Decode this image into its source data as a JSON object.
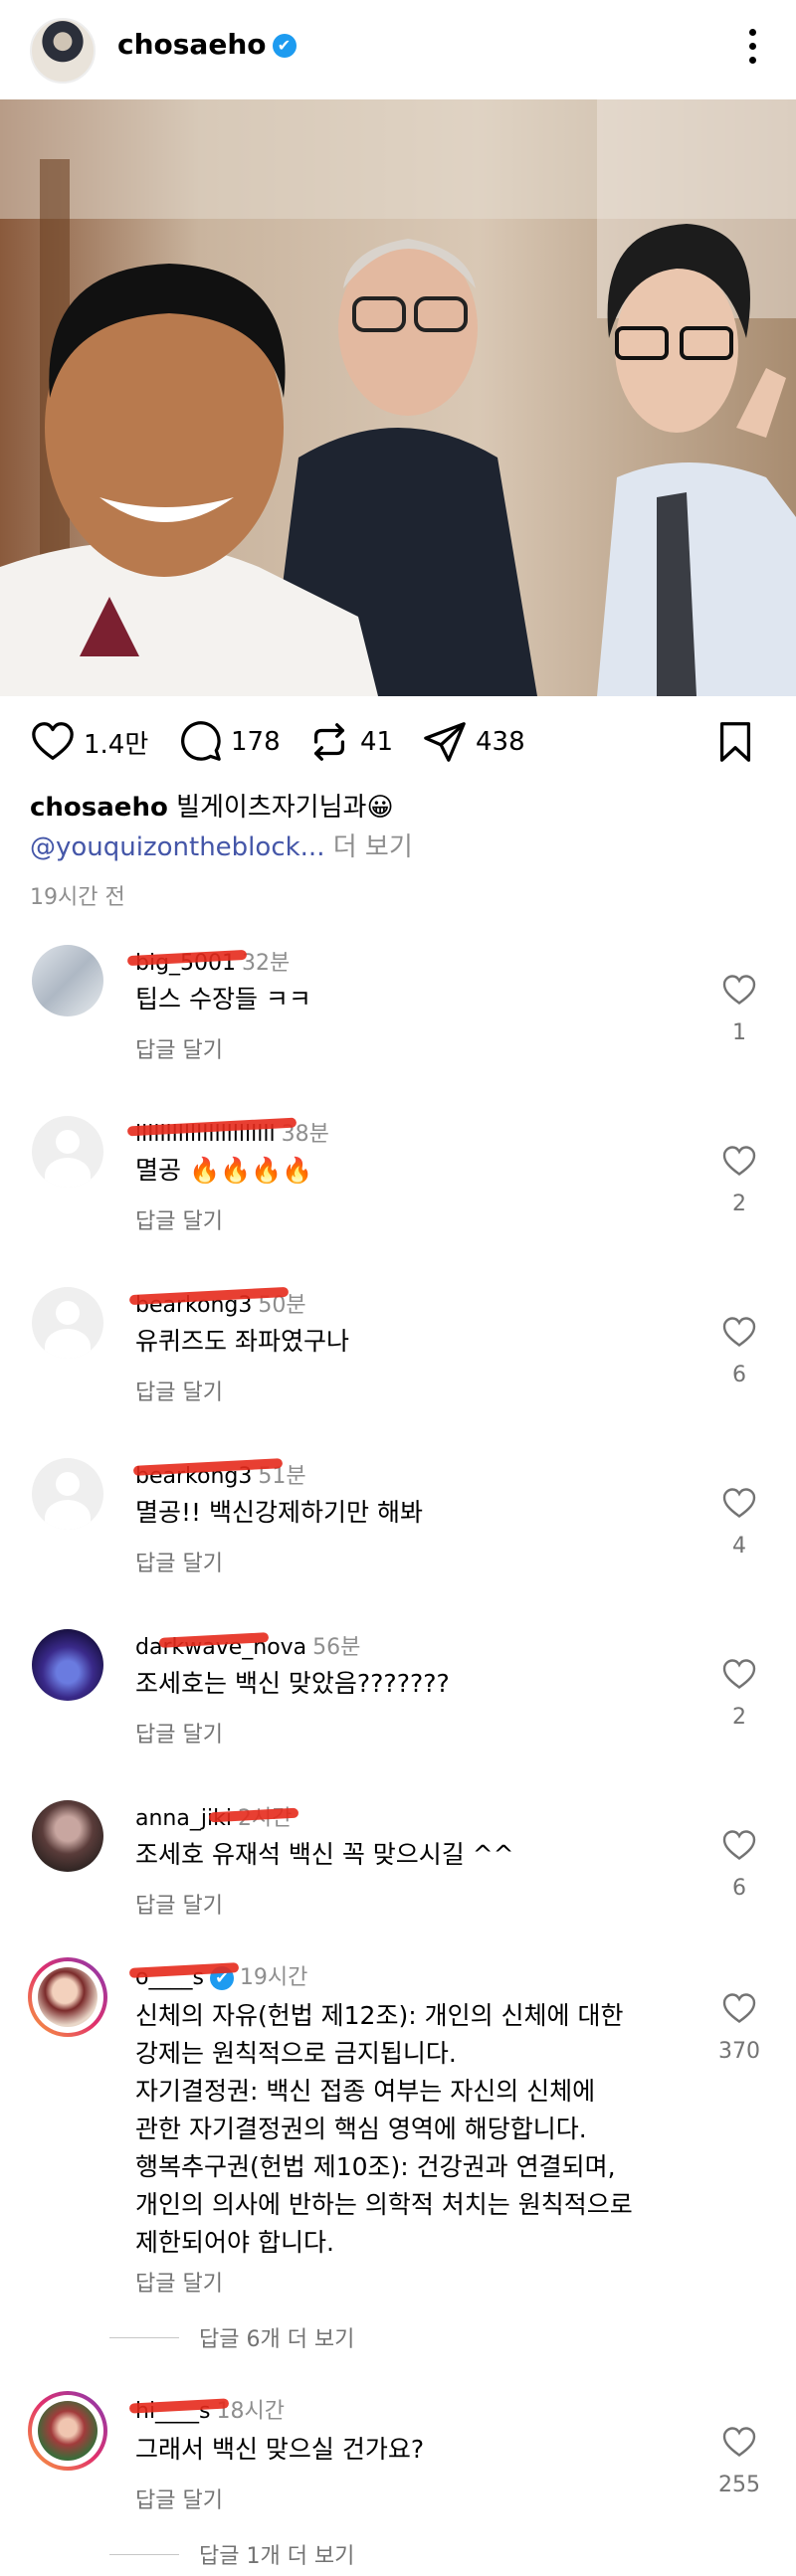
{
  "header": {
    "username": "chosaeho",
    "verified_icon": "✔"
  },
  "post": {
    "likes": "1.4만",
    "comments": "178",
    "reposts": "41",
    "shares": "438"
  },
  "caption": {
    "username": "chosaeho",
    "text": "빌게이츠자기님과😀",
    "mention": "@youquizontheblock...",
    "more": "더 보기",
    "time": "19시간 전"
  },
  "comments": [
    {
      "user": "big_5001",
      "time": "32분",
      "text": "팁스 수장들 ㅋㅋ",
      "reply": "답글 달기",
      "likes": "1"
    },
    {
      "user": "lllllllllllllllllllllll",
      "time": "38분",
      "text": "멸공 🔥🔥🔥🔥",
      "reply": "답글 달기",
      "likes": "2"
    },
    {
      "user": "bearkong3",
      "time": "50분",
      "text": "유퀴즈도 좌파였구나",
      "reply": "답글 달기",
      "likes": "6"
    },
    {
      "user": "bearkong3",
      "time": "51분",
      "text": "멸공!! 백신강제하기만 해봐",
      "reply": "답글 달기",
      "likes": "4"
    },
    {
      "user": "darkwave_nova",
      "time": "56분",
      "text": "조세호는 백신 맞았음???????",
      "reply": "답글 달기",
      "likes": "2"
    },
    {
      "user": "anna_jiki",
      "time": "2시간",
      "text": "조세호 유재석 백신 꼭 맞으시길 ^^",
      "reply": "답글 달기",
      "likes": "6"
    },
    {
      "user": "o____s",
      "time": "19시간",
      "lines": [
        "신체의 자유(헌법 제12조): 개인의 신체에 대한",
        "강제는 원칙적으로 금지됩니다.",
        "자기결정권: 백신 접종 여부는 자신의 신체에",
        "관한 자기결정권의 핵심 영역에 해당합니다.",
        "행복추구권(헌법 제10조): 건강권과 연결되며,",
        "개인의 의사에 반하는 의학적 처치는 원칙적으로",
        "제한되어야 합니다."
      ],
      "reply": "답글 달기",
      "likes": "370",
      "view_more": "답글 6개 더 보기"
    },
    {
      "user": "hi____s",
      "time": "18시간",
      "text": "그래서 백신 맞으실 건가요?",
      "reply": "답글 달기",
      "likes": "255",
      "view_more": "답글 1개 더 보기"
    }
  ]
}
